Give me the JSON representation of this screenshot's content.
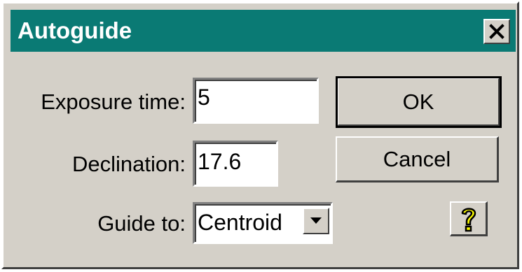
{
  "window": {
    "title": "Autoguide",
    "close_icon": "close-x-icon"
  },
  "form": {
    "exposure_label": "Exposure time:",
    "exposure_value": "5",
    "declination_label": "Declination:",
    "declination_value": "17.6",
    "guide_label": "Guide to:",
    "guide_value": "Centroid"
  },
  "buttons": {
    "ok_label": "OK",
    "cancel_label": "Cancel",
    "help_icon": "question-mark-icon"
  },
  "colors": {
    "titlebar": "#0a7a74",
    "face": "#d4d0c8",
    "help_glyph": "#ffff00"
  }
}
